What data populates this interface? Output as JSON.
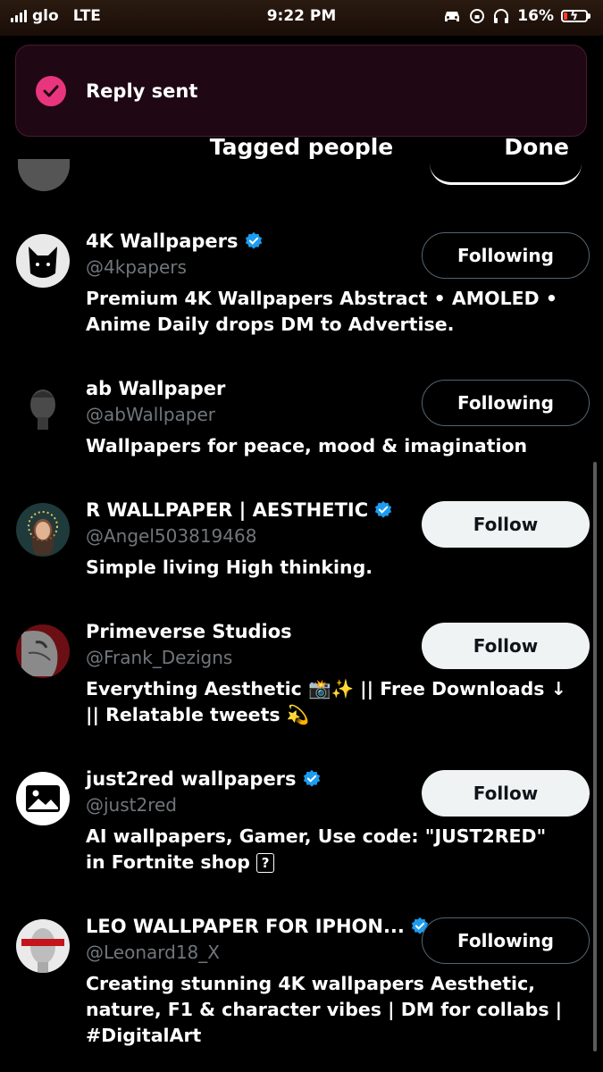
{
  "status_bar": {
    "carrier": "glo",
    "network": "LTE",
    "time": "9:22 PM",
    "battery": "16%"
  },
  "toast": {
    "message": "Reply sent",
    "icon": "check-circle-icon",
    "accent": "#e8357e"
  },
  "header": {
    "title": "Tagged people",
    "done_label": "Done"
  },
  "accounts": [
    {
      "name": "4K Wallpapers",
      "verified": true,
      "handle": "@4kpapers",
      "bio": "Premium 4K Wallpapers Abstract • AMOLED • Anime Daily drops DM to Advertise.",
      "button": "Following"
    },
    {
      "name": "ab Wallpaper",
      "verified": false,
      "handle": "@abWallpaper",
      "bio": "Wallpapers for peace, mood & imagination",
      "button": "Following"
    },
    {
      "name": "R WALLPAPER | AESTHETIC",
      "verified": true,
      "handle": "@Angel503819468",
      "bio": "Simple living High thinking.",
      "button": "Follow"
    },
    {
      "name": "Primeverse Studios",
      "verified": false,
      "handle": "@Frank_Dezigns",
      "bio": "Everything Aesthetic 📸✨ || Free Downloads ↓ || Relatable tweets 💫",
      "button": "Follow"
    },
    {
      "name": "just2red wallpapers",
      "verified": true,
      "handle": "@just2red",
      "bio": "AI wallpapers, Gamer, Use code: \"JUST2RED\" in Fortnite shop",
      "button": "Follow"
    },
    {
      "name": "LEO WALLPAPER FOR IPHON...",
      "verified": true,
      "handle": "@Leonard18_X",
      "bio": "Creating stunning 4K wallpapers Aesthetic, nature, F1 & character vibes | DM for collabs | #DigitalArt",
      "button": "Following"
    }
  ],
  "colors": {
    "verified": "#1d9bf0",
    "handle": "#71767b",
    "follow_bg": "#eff3f4"
  }
}
